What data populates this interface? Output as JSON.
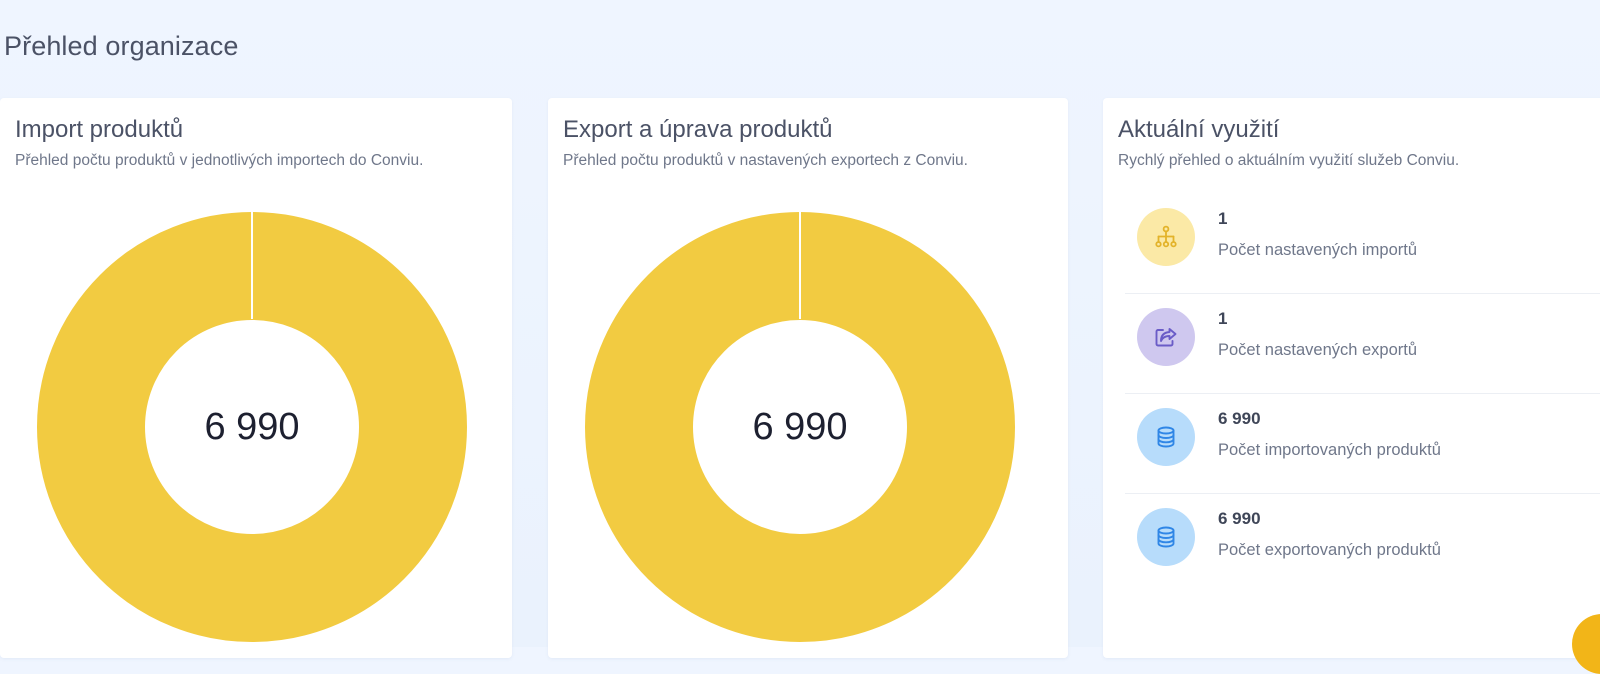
{
  "page": {
    "title": "Přehled organizace"
  },
  "colors": {
    "donut": "#f2cb41",
    "import_icon_bg": "#fbe9a6",
    "import_icon": "#e3b32a",
    "export_icon_bg": "#cfc8ef",
    "export_icon": "#6a5cc7",
    "db_icon_bg": "#b7dcfb",
    "db_icon": "#2f86e6",
    "fab": "#f2b518"
  },
  "import_card": {
    "title": "Import produktů",
    "subtitle": "Přehled počtu produktů v jednotlivých importech do Conviu.",
    "total": "6 990"
  },
  "export_card": {
    "title": "Export a úprava produktů",
    "subtitle": "Přehled počtu produktů v nastavených exportech z Conviu.",
    "total": "6 990"
  },
  "usage_card": {
    "title": "Aktuální využití",
    "subtitle": "Rychlý přehled o aktuálním využití služeb Conviu.",
    "items": [
      {
        "icon": "sitemap-icon",
        "value": "1",
        "label": "Počet nastavených importů"
      },
      {
        "icon": "share-icon",
        "value": "1",
        "label": "Počet nastavených exportů"
      },
      {
        "icon": "database-icon",
        "value": "6 990",
        "label": "Počet importovaných produktů"
      },
      {
        "icon": "database-icon",
        "value": "6 990",
        "label": "Počet exportovaných produktů"
      }
    ]
  },
  "chart_data": [
    {
      "type": "pie",
      "title": "Import produktů",
      "center_label": "6 990",
      "values": [
        6990
      ],
      "colors": [
        "#f2cb41"
      ]
    },
    {
      "type": "pie",
      "title": "Export a úprava produktů",
      "center_label": "6 990",
      "values": [
        6990
      ],
      "colors": [
        "#f2cb41"
      ]
    }
  ]
}
